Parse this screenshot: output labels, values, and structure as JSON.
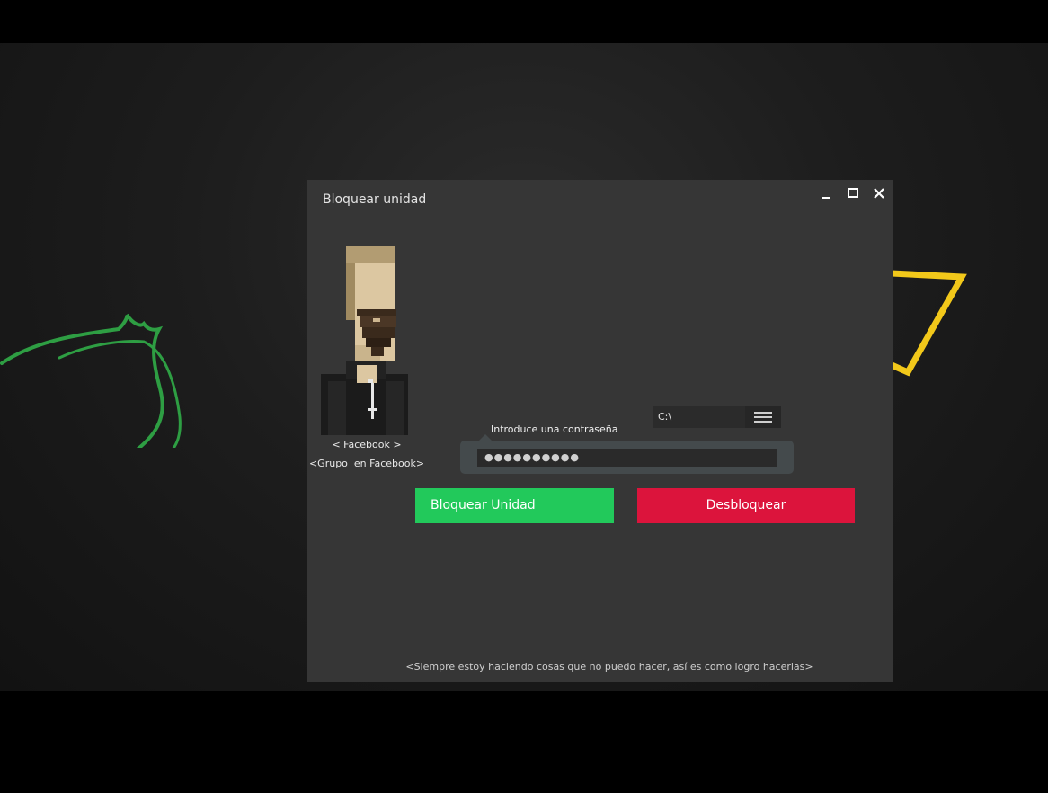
{
  "window": {
    "title": "Bloquear unidad",
    "controls": {
      "minimize_icon": "minimize-icon",
      "maximize_icon": "maximize-icon",
      "close_icon": "close-icon"
    }
  },
  "profile": {
    "avatar": "pixel-art-bearded-man-avatar",
    "facebook_link": "< Facebook >",
    "group_link": "<Grupo  en Facebook>"
  },
  "drive": {
    "value": "C:\\",
    "menu_icon": "hamburger-menu-icon"
  },
  "password": {
    "label": "Introduce una contraseña",
    "masked_value": "●●●●●●●●●●"
  },
  "actions": {
    "lock_label": "Bloquear Unidad",
    "unlock_label": "Desbloquear"
  },
  "footer": {
    "text": "<Siempre estoy haciendo cosas que no puedo hacer, así es como logro hacerlas>"
  },
  "colors": {
    "window_bg": "#363636",
    "lock_button": "#22c95b",
    "unlock_button": "#dc143c",
    "deco_green": "#2e9e43",
    "deco_yellow": "#f2c81a"
  }
}
